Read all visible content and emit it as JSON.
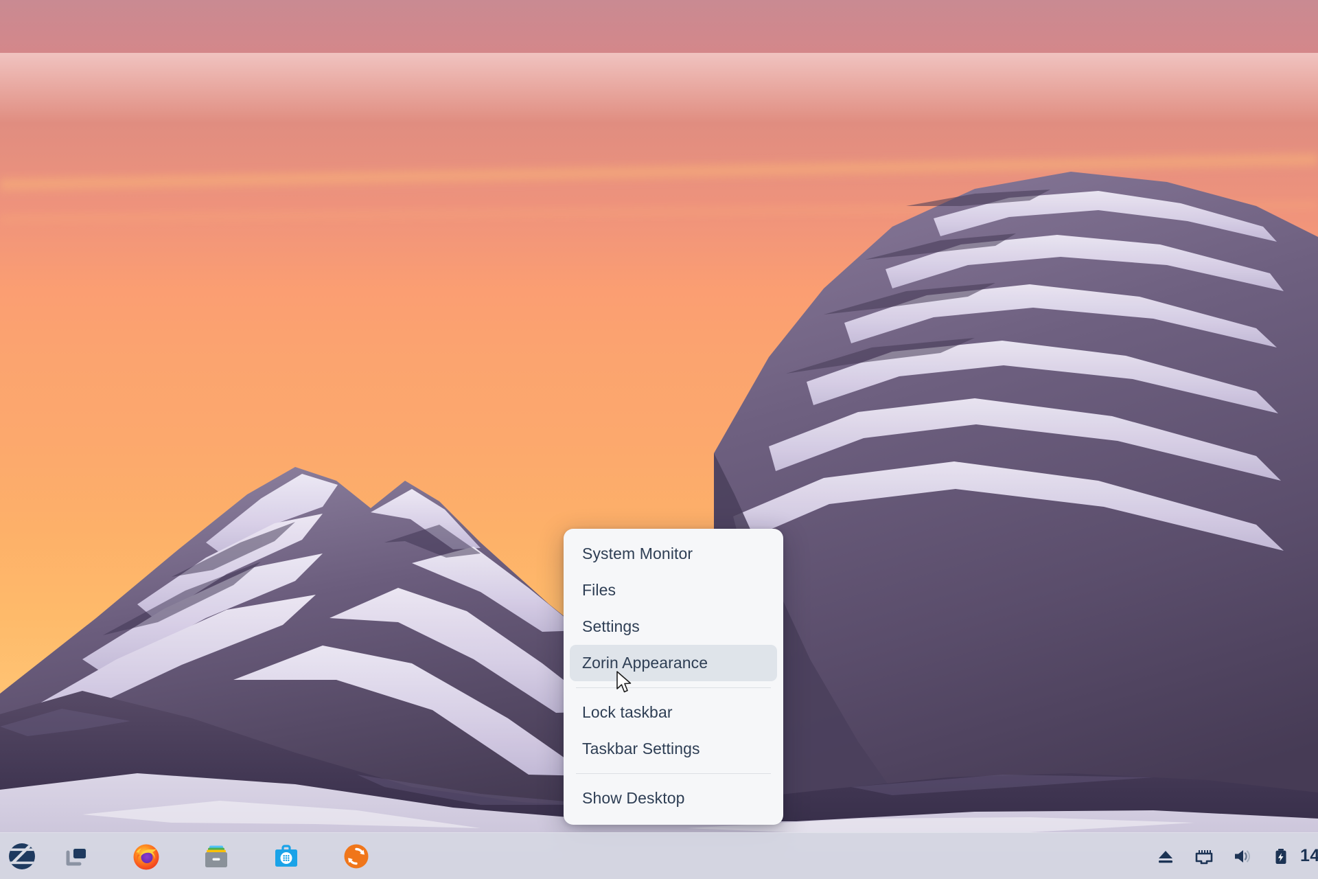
{
  "desktop": {
    "wallpaper_name": "mountain-sunset-wallpaper",
    "sky_top_color": "#c98a92",
    "sky_bottom_color": "#ffd79a",
    "rock_color": "#6d5f7e",
    "snow_color": "#e4def0"
  },
  "context_menu": {
    "name": "taskbar-context-menu",
    "groups": [
      {
        "items": [
          {
            "label": "System Monitor",
            "name": "menu-item-system-monitor",
            "highlighted": false
          },
          {
            "label": "Files",
            "name": "menu-item-files",
            "highlighted": false
          },
          {
            "label": "Settings",
            "name": "menu-item-settings",
            "highlighted": false
          },
          {
            "label": "Zorin Appearance",
            "name": "menu-item-zorin-appearance",
            "highlighted": true
          }
        ]
      },
      {
        "items": [
          {
            "label": "Lock taskbar",
            "name": "menu-item-lock-taskbar",
            "highlighted": false
          },
          {
            "label": "Taskbar Settings",
            "name": "menu-item-taskbar-settings",
            "highlighted": false
          }
        ]
      },
      {
        "items": [
          {
            "label": "Show Desktop",
            "name": "menu-item-show-desktop",
            "highlighted": false
          }
        ]
      }
    ],
    "highlight_color": "#dfe4ea",
    "text_color": "#2e3e54",
    "background_color": "#f6f7f9"
  },
  "taskbar": {
    "background_color": "#d6d8e3",
    "launchers": [
      {
        "label": "Zorin Menu",
        "icon": "zorin-logo-icon"
      },
      {
        "label": "Workspace Switcher",
        "icon": "workspace-switcher-icon"
      },
      {
        "label": "Firefox Web Browser",
        "icon": "firefox-icon"
      },
      {
        "label": "Files",
        "icon": "files-cabinet-icon"
      },
      {
        "label": "Software",
        "icon": "software-store-icon"
      },
      {
        "label": "Software Updater",
        "icon": "software-updater-icon"
      }
    ],
    "tray": [
      {
        "label": "Removable media",
        "icon": "eject-icon"
      },
      {
        "label": "Wired network connected",
        "icon": "ethernet-icon"
      },
      {
        "label": "Volume",
        "icon": "volume-icon"
      },
      {
        "label": "Battery charging",
        "icon": "battery-charging-icon"
      }
    ],
    "clock": "14"
  }
}
